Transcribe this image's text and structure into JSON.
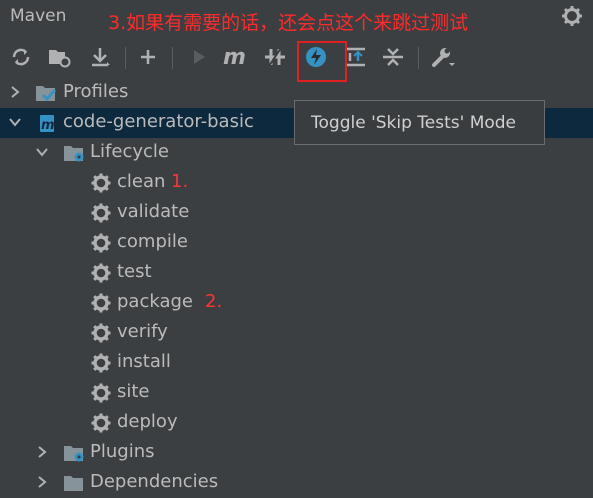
{
  "panel": {
    "title": "Maven"
  },
  "annotation_top": "3.如果有需要的话，还会点这个来跳过测试",
  "toolbar": {
    "buttons": [
      {
        "icon": "reload-icon"
      },
      {
        "icon": "add-folder-icon"
      },
      {
        "icon": "download-icon"
      },
      {
        "icon": "plus-icon"
      },
      {
        "icon": "run-icon"
      },
      {
        "icon": "maven-goal-icon"
      },
      {
        "icon": "toggle-offline-icon"
      },
      {
        "icon": "skip-tests-icon"
      },
      {
        "icon": "show-dependencies-icon"
      },
      {
        "icon": "collapse-all-icon"
      },
      {
        "icon": "settings-wrench-icon"
      }
    ]
  },
  "tooltip": {
    "text": "Toggle 'Skip Tests' Mode"
  },
  "tree": {
    "profiles": "Profiles",
    "project": "code-generator-basic",
    "lifecycle": "Lifecycle",
    "goals": [
      "clean",
      "validate",
      "compile",
      "test",
      "package",
      "verify",
      "install",
      "site",
      "deploy"
    ],
    "plugins": "Plugins",
    "dependencies": "Dependencies"
  },
  "annotations": {
    "clean": "1.",
    "package": "2."
  },
  "colors": {
    "background": "#3c3f41",
    "selected_row": "#0d293e",
    "annotation": "#ff2a2a",
    "accent": "#3592c4"
  }
}
